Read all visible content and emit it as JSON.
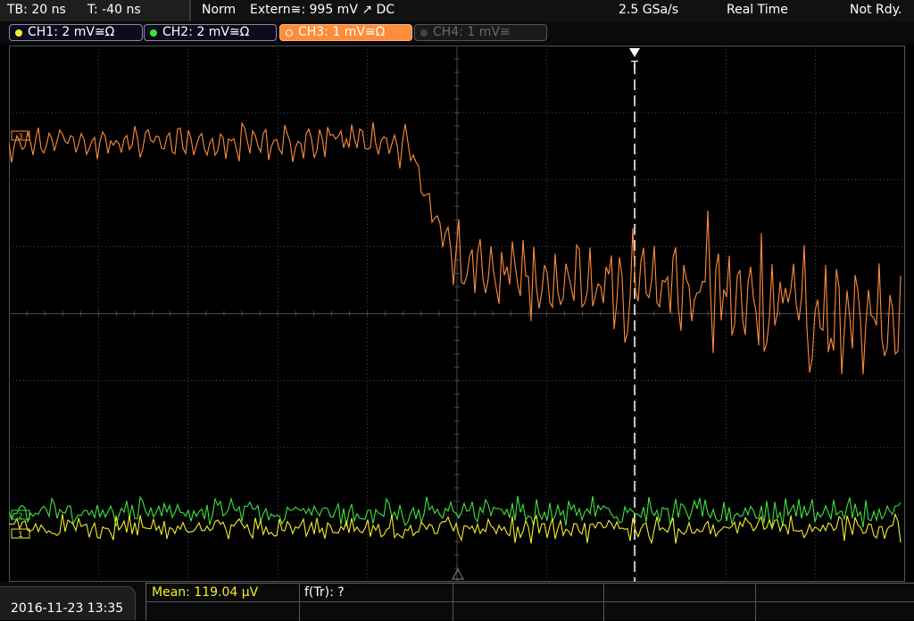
{
  "header": {
    "timebase": "TB: 20 ns",
    "trigger_time": "T: -40 ns",
    "trigger_mode": "Norm",
    "trigger_source": "Extern≅: 995 mV ↗ DC",
    "sample_rate": "2.5 GSa/s",
    "acq_mode": "Real Time",
    "status": "Not Rdy."
  },
  "channels": [
    {
      "label": "CH1: 2 mV≅Ω",
      "color": "#f2ee2a",
      "active": true
    },
    {
      "label": "CH2: 2 mV≅Ω",
      "color": "#3fe23f",
      "active": true
    },
    {
      "label": "CH3: 1 mV≅Ω",
      "color": "#ff8c3a",
      "active": true
    },
    {
      "label": "CH4: 1 mV≅",
      "color": "#7a7a7a",
      "active": false
    }
  ],
  "markers": {
    "ch1": "1",
    "ch2": "2",
    "ch3": "3",
    "trigger": "T"
  },
  "footer": {
    "datetime": "2016-11-23 13:35",
    "mean_label": "Mean: 119.04 µV",
    "rise_label": "f(Tr): ?"
  },
  "colors": {
    "ch1": "#f2ee2a",
    "ch2": "#3fe23f",
    "ch3": "#ff8c3a",
    "grid": "#4a4a4a",
    "trigger_line": "#ffffff"
  }
}
